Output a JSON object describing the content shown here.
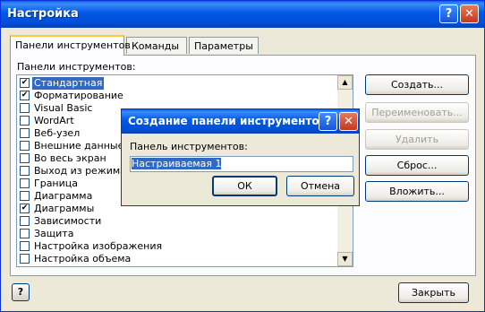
{
  "window": {
    "title": "Настройка",
    "help_glyph": "?",
    "close_glyph": "✕"
  },
  "tabs": [
    {
      "label": "Панели инструментов",
      "active": true
    },
    {
      "label": "Команды",
      "active": false
    },
    {
      "label": "Параметры",
      "active": false
    }
  ],
  "toolbar_list": {
    "label": "Панели инструментов:",
    "items": [
      {
        "label": "Стандартная",
        "checked": true,
        "selected": true
      },
      {
        "label": "Форматирование",
        "checked": true,
        "selected": false
      },
      {
        "label": "Visual Basic",
        "checked": false,
        "selected": false
      },
      {
        "label": "WordArt",
        "checked": false,
        "selected": false
      },
      {
        "label": "Веб-узел",
        "checked": false,
        "selected": false
      },
      {
        "label": "Внешние данные",
        "checked": false,
        "selected": false
      },
      {
        "label": "Во весь экран",
        "checked": false,
        "selected": false
      },
      {
        "label": "Выход из режима ко",
        "checked": false,
        "selected": false
      },
      {
        "label": "Граница",
        "checked": false,
        "selected": false
      },
      {
        "label": "Диаграмма",
        "checked": false,
        "selected": false
      },
      {
        "label": "Диаграммы",
        "checked": true,
        "selected": false
      },
      {
        "label": "Зависимости",
        "checked": false,
        "selected": false
      },
      {
        "label": "Защита",
        "checked": false,
        "selected": false
      },
      {
        "label": "Настройка изображения",
        "checked": false,
        "selected": false
      },
      {
        "label": "Настройка объема",
        "checked": false,
        "selected": false
      }
    ]
  },
  "buttons": {
    "create": "Создать...",
    "rename": "Переименовать...",
    "delete": "Удалить",
    "reset": "Сброс...",
    "attach": "Вложить...",
    "close": "Закрыть",
    "help_glyph": "?"
  },
  "dialog": {
    "title": "Создание панели инструментов",
    "help_glyph": "?",
    "close_glyph": "✕",
    "field_label": "Панель инструментов:",
    "field_value": "Настраиваемая 1",
    "ok": "ОК",
    "cancel": "Отмена"
  },
  "colors": {
    "titlebar": "#0058e6",
    "selection": "#316ac5",
    "face": "#ece9d8"
  }
}
